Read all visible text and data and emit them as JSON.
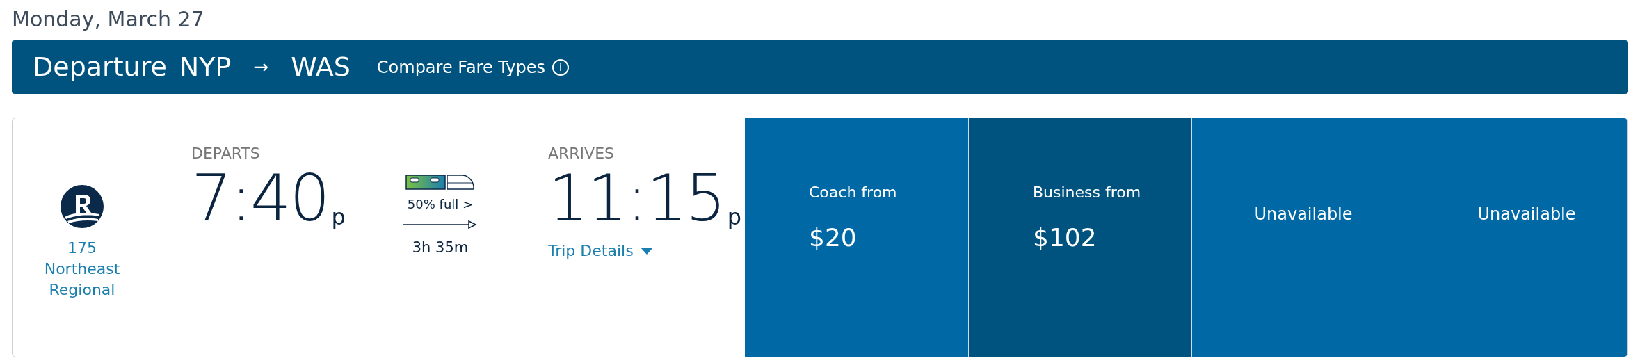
{
  "date": "Monday, March 27",
  "header": {
    "direction": "Departure",
    "origin": "NYP",
    "arrow": "→",
    "destination": "WAS",
    "compare_link": "Compare Fare Types",
    "info_icon": "i"
  },
  "train": {
    "number": "175",
    "name": "Northeast Regional"
  },
  "departs": {
    "label": "DEPARTS",
    "time": "7:40",
    "ampm": "p"
  },
  "occupancy": "50% full >",
  "duration": "3h 35m",
  "arrives": {
    "label": "ARRIVES",
    "time": "11:15",
    "ampm": "p"
  },
  "trip_details": "Trip Details",
  "fares": [
    {
      "kind": "price",
      "label": "Coach from",
      "price": "$20",
      "selected": false
    },
    {
      "kind": "price",
      "label": "Business from",
      "price": "$102",
      "selected": true
    },
    {
      "kind": "unavailable",
      "label": "Unavailable",
      "selected": false
    },
    {
      "kind": "unavailable",
      "label": "Unavailable",
      "selected": false
    }
  ]
}
